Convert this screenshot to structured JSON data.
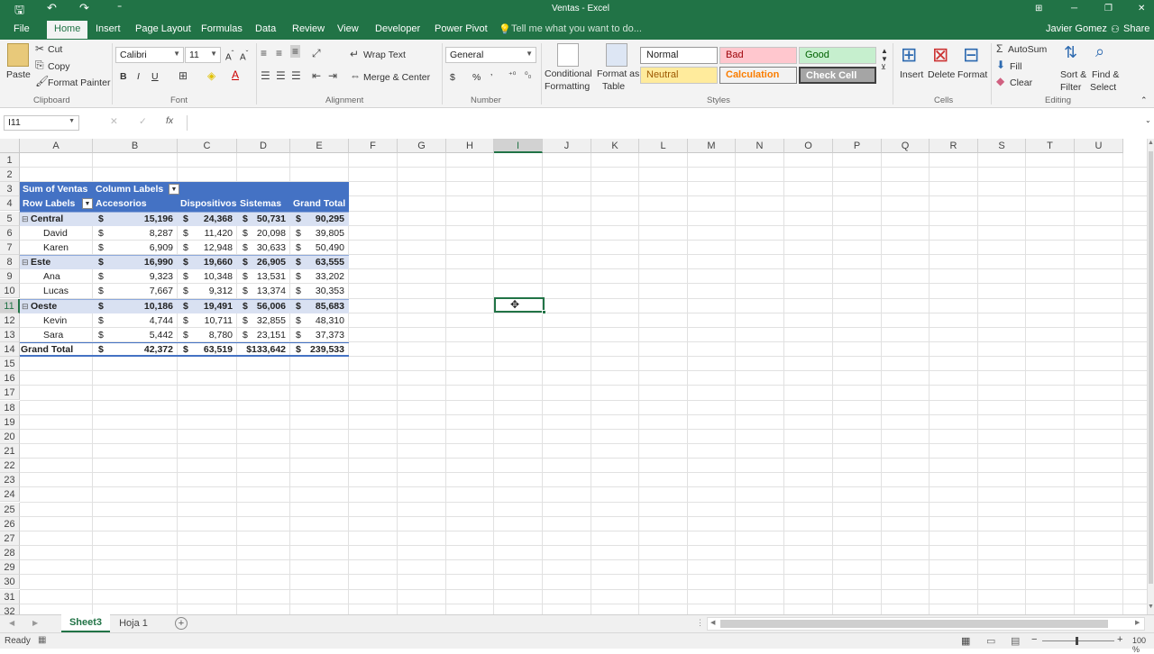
{
  "titlebar": {
    "title": "Ventas - Excel",
    "save_icon": "save-icon",
    "undo": "↶",
    "redo": "↷",
    "qat": "⁼",
    "restore": "⧉",
    "min": "─",
    "max": "❐",
    "close": "✕",
    "ribbon_opts": "⊞"
  },
  "tabs": [
    {
      "label": "File"
    },
    {
      "label": "Home"
    },
    {
      "label": "Insert"
    },
    {
      "label": "Page Layout"
    },
    {
      "label": "Formulas"
    },
    {
      "label": "Data"
    },
    {
      "label": "Review"
    },
    {
      "label": "View"
    },
    {
      "label": "Developer"
    },
    {
      "label": "Power Pivot"
    }
  ],
  "tellme": "Tell me what you want to do...",
  "user": "Javier Gomez",
  "share": "Share",
  "ribbon": {
    "clipboard": {
      "paste": "Paste",
      "cut": "Cut",
      "copy": "Copy",
      "format_painter": "Format Painter",
      "label": "Clipboard"
    },
    "font": {
      "name": "Calibri",
      "size": "11",
      "bold": "B",
      "italic": "I",
      "underline": "U",
      "label": "Font"
    },
    "alignment": {
      "wrap": "Wrap Text",
      "merge": "Merge & Center",
      "label": "Alignment"
    },
    "number": {
      "format": "General",
      "currency": "$",
      "percent": "%",
      "comma": "’",
      "label": "Number"
    },
    "styles": {
      "conditional": "Conditional",
      "conditional2": "Formatting",
      "format_as": "Format as",
      "format_as2": "Table",
      "normal": "Normal",
      "bad": "Bad",
      "good": "Good",
      "neutral": "Neutral",
      "calculation": "Calculation",
      "check": "Check Cell",
      "label": "Styles"
    },
    "cells": {
      "insert": "Insert",
      "delete": "Delete",
      "format": "Format",
      "label": "Cells"
    },
    "editing": {
      "autosum": "AutoSum",
      "fill": "Fill",
      "clear": "Clear",
      "sort": "Sort &",
      "sort2": "Filter",
      "find": "Find &",
      "find2": "Select",
      "label": "Editing"
    }
  },
  "formula_bar": {
    "name_box": "I11",
    "fx": "fx",
    "cancel": "✕",
    "enter": "✓",
    "formula": ""
  },
  "columns": [
    "A",
    "B",
    "C",
    "D",
    "E",
    "F",
    "G",
    "H",
    "I",
    "J",
    "K",
    "L",
    "M",
    "N",
    "O",
    "P",
    "Q",
    "R",
    "S",
    "T",
    "U"
  ],
  "rows": [
    "1",
    "2",
    "3",
    "4",
    "5",
    "6",
    "7",
    "8",
    "9",
    "10",
    "11",
    "12",
    "13",
    "14",
    "15",
    "16",
    "17",
    "18",
    "19",
    "20",
    "21",
    "22",
    "23",
    "24",
    "25",
    "26",
    "27",
    "28",
    "29",
    "30",
    "31",
    "32"
  ],
  "pivot": {
    "header": {
      "sum": "Sum of Ventas",
      "col_labels": "Column Labels"
    },
    "subheader": {
      "row_labels": "Row Labels",
      "c1": "Accesorios",
      "c2": "Dispositivos",
      "c3": "Sistemas",
      "c4": "Grand Total"
    },
    "rows": [
      {
        "label": "Central",
        "type": "group",
        "v": [
          "15,196",
          "24,368",
          "50,731",
          "90,295"
        ]
      },
      {
        "label": "David",
        "type": "item",
        "v": [
          "8,287",
          "11,420",
          "20,098",
          "39,805"
        ]
      },
      {
        "label": "Karen",
        "type": "item",
        "v": [
          "6,909",
          "12,948",
          "30,633",
          "50,490"
        ]
      },
      {
        "label": "Este",
        "type": "group",
        "v": [
          "16,990",
          "19,660",
          "26,905",
          "63,555"
        ]
      },
      {
        "label": "Ana",
        "type": "item",
        "v": [
          "9,323",
          "10,348",
          "13,531",
          "33,202"
        ]
      },
      {
        "label": "Lucas",
        "type": "item",
        "v": [
          "7,667",
          "9,312",
          "13,374",
          "30,353"
        ]
      },
      {
        "label": "Oeste",
        "type": "group",
        "v": [
          "10,186",
          "19,491",
          "56,006",
          "85,683"
        ]
      },
      {
        "label": "Kevin",
        "type": "item",
        "v": [
          "4,744",
          "10,711",
          "32,855",
          "48,310"
        ]
      },
      {
        "label": "Sara",
        "type": "item",
        "v": [
          "5,442",
          "8,780",
          "23,151",
          "37,373"
        ]
      }
    ],
    "total": {
      "label": "Grand Total",
      "v": [
        "42,372",
        "63,519",
        "$133,642",
        "239,533"
      ]
    },
    "dollar": "$",
    "collapse": "⊟"
  },
  "sheets": {
    "active": "Sheet3",
    "other": "Hoja 1",
    "add": "+"
  },
  "status": {
    "ready": "Ready",
    "zoom": "100 %"
  },
  "colors": {
    "excel_green": "#217346",
    "pivot_header": "#4472C4",
    "pivot_sub": "#D9E1F2"
  }
}
